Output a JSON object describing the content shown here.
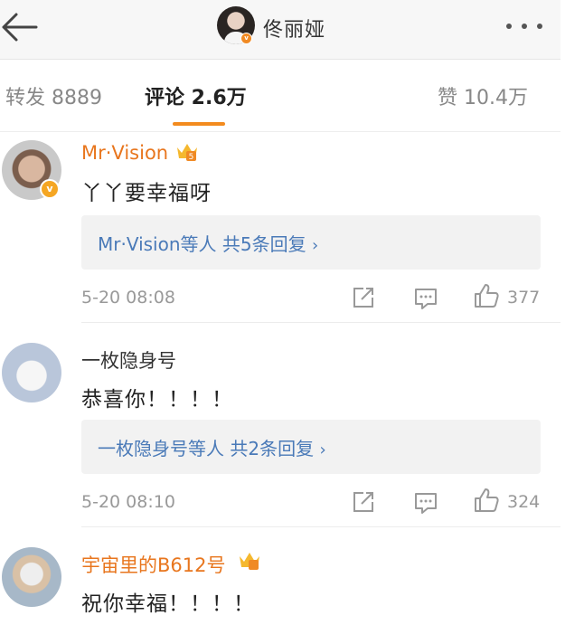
{
  "header": {
    "author_name": "佟丽娅",
    "author_badge": "v",
    "icons": {
      "back": "back-arrow-icon",
      "more": "more-dots-icon"
    }
  },
  "tabs": {
    "repost": "转发 8889",
    "comments": "评论 2.6万",
    "likes": "赞 10.4万"
  },
  "colors": {
    "accent": "#f38b1e",
    "vip_name": "#e8761e",
    "link": "#4a7ab8"
  },
  "comments": [
    {
      "username": "Mr·Vision",
      "vip": true,
      "verified": true,
      "text": "丫丫要幸福呀",
      "reply_prefix": "Mr·Vision等人",
      "reply_count": "共5条回复",
      "time": "5-20 08:08",
      "likes": "377"
    },
    {
      "username": "一枚隐身号",
      "vip": false,
      "verified": false,
      "text": "恭喜你！！！！",
      "reply_prefix": "一枚隐身号等人",
      "reply_count": "共2条回复",
      "time": "5-20 08:10",
      "likes": "324"
    },
    {
      "username": "宇宙里的B612号",
      "vip": true,
      "verified": false,
      "text": "祝你幸福！！！！"
    }
  ],
  "reply_arrow": "›",
  "icon_names": [
    "share-icon",
    "comment-icon",
    "like-icon",
    "crown-icon"
  ]
}
